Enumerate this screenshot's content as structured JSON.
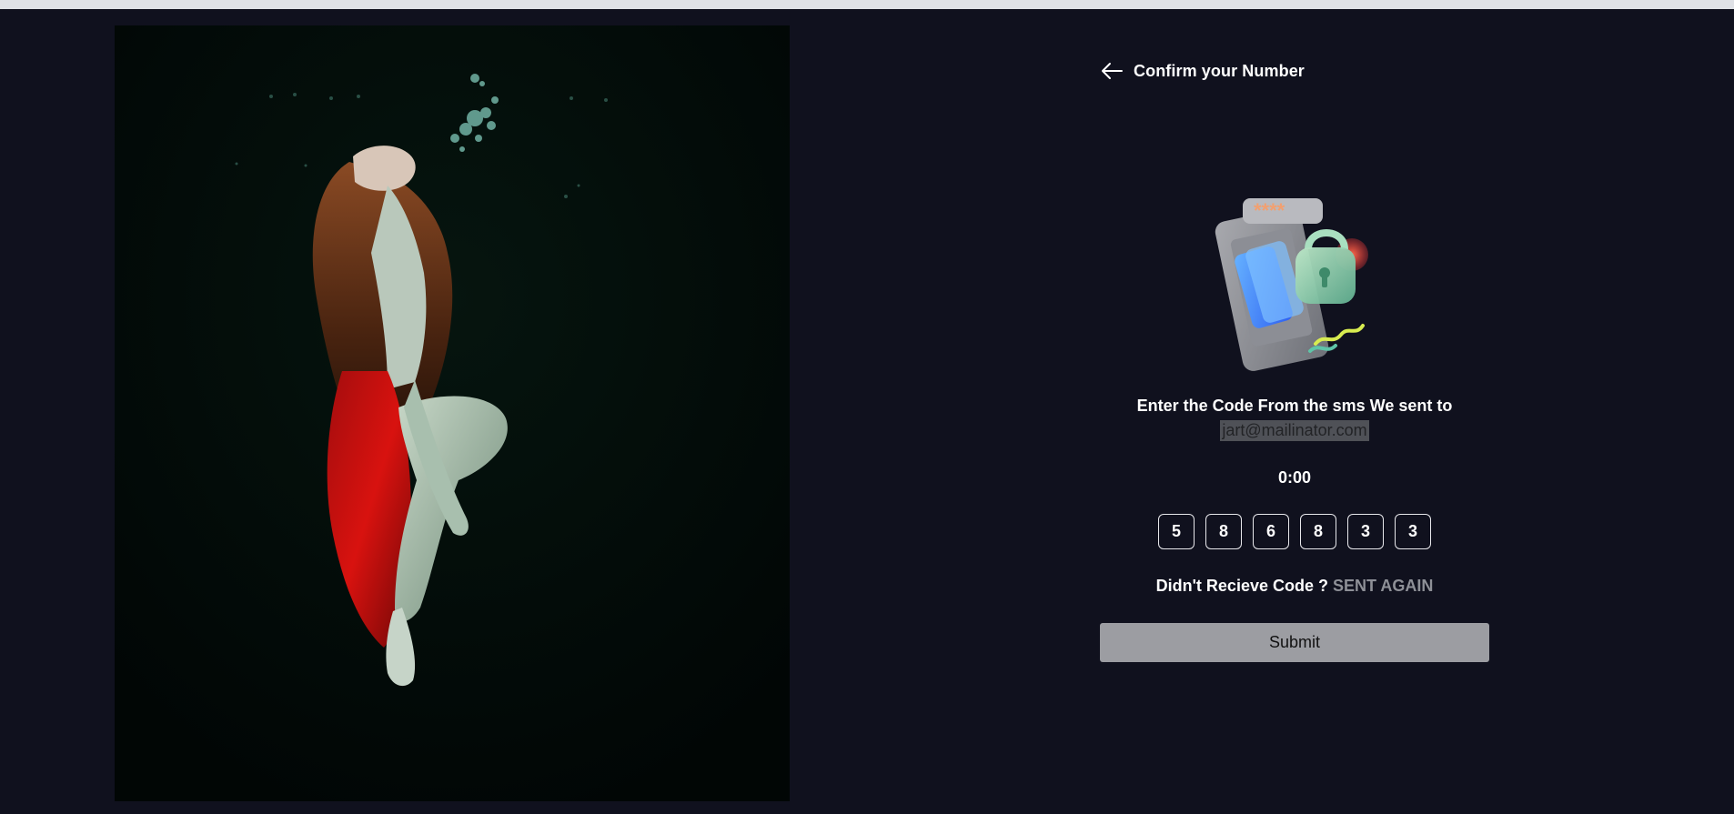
{
  "header": {
    "title": "Confirm your Number",
    "back_icon": "arrow-left-icon"
  },
  "illustration": {
    "icon": "phone-lock-icon",
    "password_mask": "****"
  },
  "verification": {
    "prompt": "Enter the Code From the sms We sent to",
    "email": "jart@mailinator.com",
    "timer": "0:00",
    "code_digits": [
      "5",
      "8",
      "6",
      "8",
      "3",
      "3"
    ]
  },
  "resend": {
    "question": "Didn't Recieve Code ?",
    "link": "SENT AGAIN"
  },
  "submit": {
    "label": "Submit"
  },
  "colors": {
    "background": "#10111e",
    "button": "#9c9da2",
    "link": "#8e9097"
  }
}
